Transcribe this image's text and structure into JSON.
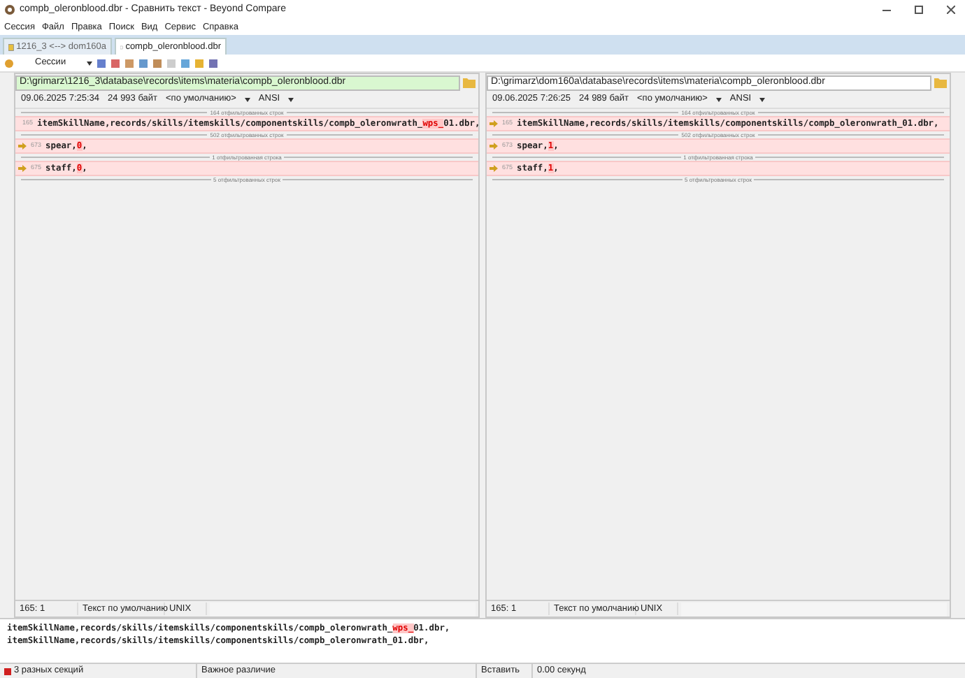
{
  "window": {
    "title": "compb_oleronblood.dbr - Сравнить текст - Beyond Compare"
  },
  "menu": [
    "Сессия",
    "Файл",
    "Правка",
    "Поиск",
    "Вид",
    "Сервис",
    "Справка"
  ],
  "tabs": [
    {
      "label": "1216_3 <--> dom160a",
      "selected": false
    },
    {
      "label": "compb_oleronblood.dbr",
      "selected": true
    }
  ],
  "toolbar": {
    "sessions_button": "Сессии"
  },
  "panes": [
    {
      "path": "D:\\grimarz\\1216_3\\database\\records\\items\\materia\\compb_oleronblood.dbr",
      "path_ok": true,
      "timestamp": "09.06.2025 7:25:34",
      "size": "24 993 байт",
      "format": "<по умолчанию>",
      "encoding": "ANSI",
      "rows": [
        {
          "kind": "gap",
          "text": "164 отфильтрованных строк"
        },
        {
          "kind": "line",
          "number": "165",
          "segments": [
            {
              "text": "itemSkillName,records/skills/itemskills/componentskills/compb_oleronwrath_",
              "changed": false
            },
            {
              "text": "wps_",
              "changed": true
            },
            {
              "text": "01.dbr,",
              "changed": false
            }
          ]
        },
        {
          "kind": "gap",
          "text": "502 отфильтрованных строк"
        },
        {
          "kind": "line",
          "number": "673",
          "segments": [
            {
              "text": "spear,",
              "changed": false
            },
            {
              "text": "0",
              "changed": true
            },
            {
              "text": ",",
              "changed": false
            }
          ]
        },
        {
          "kind": "gap",
          "text": "1 отфильтрованная строка"
        },
        {
          "kind": "line",
          "number": "675",
          "segments": [
            {
              "text": "staff,",
              "changed": false
            },
            {
              "text": "0",
              "changed": true
            },
            {
              "text": ",",
              "changed": false
            }
          ]
        },
        {
          "kind": "gap",
          "text": "5 отфильтрованных строк"
        }
      ],
      "footer": {
        "position": "165: 1",
        "syntax": "Текст по умолчанию",
        "line_ending": "UNIX"
      }
    },
    {
      "path": "D:\\grimarz\\dom160a\\database\\records\\items\\materia\\compb_oleronblood.dbr",
      "path_ok": false,
      "timestamp": "09.06.2025 7:26:25",
      "size": "24 989 байт",
      "format": "<по умолчанию>",
      "encoding": "ANSI",
      "rows": [
        {
          "kind": "gap",
          "text": "164 отфильтрованных строк"
        },
        {
          "kind": "line",
          "number": "165",
          "segments": [
            {
              "text": "itemSkillName,records/skills/itemskills/componentskills/compb_oleronwrath_01.dbr,",
              "changed": false
            }
          ]
        },
        {
          "kind": "gap",
          "text": "502 отфильтрованных строк"
        },
        {
          "kind": "line",
          "number": "673",
          "segments": [
            {
              "text": "spear,",
              "changed": false
            },
            {
              "text": "1",
              "changed": true
            },
            {
              "text": ",",
              "changed": false
            }
          ]
        },
        {
          "kind": "gap",
          "text": "1 отфильтрованная строка"
        },
        {
          "kind": "line",
          "number": "675",
          "segments": [
            {
              "text": "staff,",
              "changed": false
            },
            {
              "text": "1",
              "changed": true
            },
            {
              "text": ",",
              "changed": false
            }
          ]
        },
        {
          "kind": "gap",
          "text": "5 отфильтрованных строк"
        }
      ],
      "footer": {
        "position": "165: 1",
        "syntax": "Текст по умолчанию",
        "line_ending": "UNIX"
      }
    }
  ],
  "line_details": [
    {
      "segments": [
        {
          "text": "itemSkillName,records/skills/itemskills/componentskills/compb_oleronwrath_",
          "changed": false
        },
        {
          "text": "wps_",
          "changed": true
        },
        {
          "text": "01.dbr,",
          "changed": false
        }
      ]
    },
    {
      "segments": [
        {
          "text": "itemSkillName,records/skills/itemskills/componentskills/compb_oleronwrath_01.dbr,",
          "changed": false
        }
      ]
    }
  ],
  "status_bar": {
    "differences": "3 разных секций",
    "importance": "Важное различие",
    "mode": "Вставить",
    "time": "0.00 секунд"
  }
}
